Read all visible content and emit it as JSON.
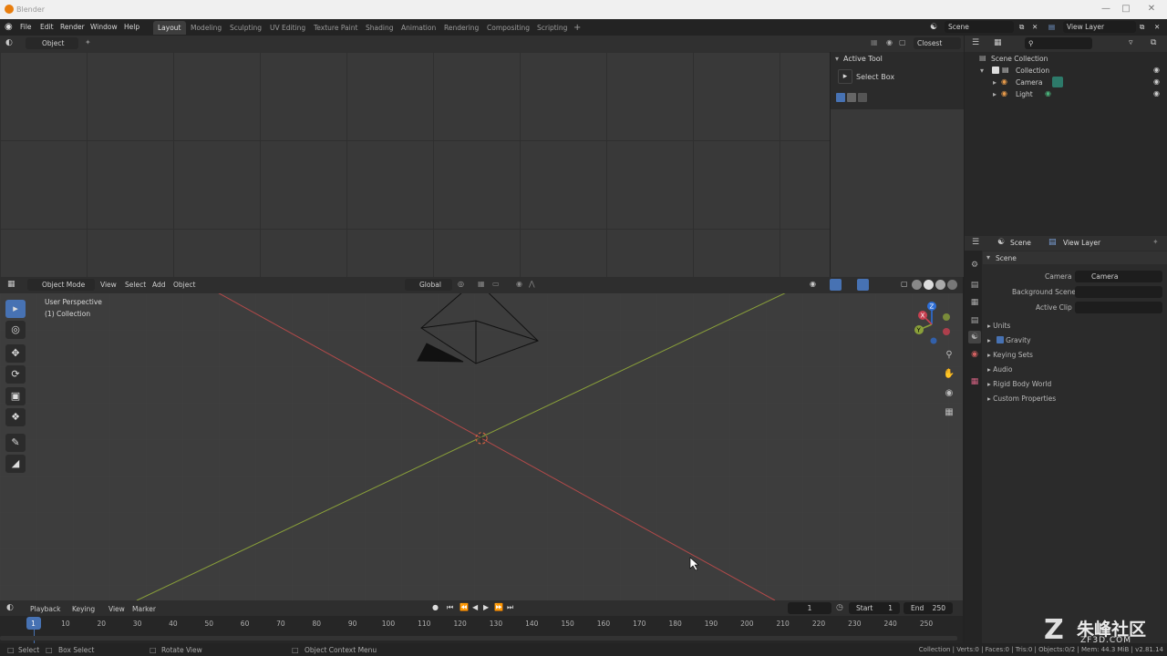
{
  "window": {
    "title": "Blender"
  },
  "menu": [
    "File",
    "Edit",
    "Render",
    "Window",
    "Help"
  ],
  "workspaces": [
    "Layout",
    "Modeling",
    "Sculpting",
    "UV Editing",
    "Texture Paint",
    "Shading",
    "Animation",
    "Rendering",
    "Compositing",
    "Scripting"
  ],
  "active_workspace": "Layout",
  "scene_selector": {
    "scene": "Scene",
    "view_layer": "View Layer"
  },
  "upper_editor": {
    "mode": "Object",
    "snap": "Closest"
  },
  "active_tool_panel": {
    "title": "Active Tool",
    "tool": "Select Box"
  },
  "viewport_header": {
    "mode": "Object Mode",
    "menus": [
      "View",
      "Select",
      "Add",
      "Object"
    ],
    "orientation": "Global"
  },
  "viewport_overlay": {
    "perspective": "User Perspective",
    "collection": "(1) Collection"
  },
  "outliner": {
    "root": "Scene Collection",
    "collection": "Collection",
    "items": [
      "Camera",
      "Light"
    ]
  },
  "properties": {
    "tabs": {
      "scene": "Scene",
      "view_layer": "View Layer"
    },
    "panel_title": "Scene",
    "camera_label": "Camera",
    "camera_value": "Camera",
    "background_scene_label": "Background Scene",
    "active_clip_label": "Active Clip",
    "sections": [
      "Units",
      "Gravity",
      "Keying Sets",
      "Audio",
      "Rigid Body World",
      "Custom Properties"
    ]
  },
  "timeline": {
    "menus": [
      "Playback",
      "Keying",
      "View",
      "Marker"
    ],
    "current_frame": "1",
    "start_label": "Start",
    "start_value": "1",
    "end_label": "End",
    "end_value": "250",
    "ruler": [
      "1",
      "10",
      "20",
      "30",
      "40",
      "50",
      "60",
      "70",
      "80",
      "90",
      "100",
      "110",
      "120",
      "130",
      "140",
      "150",
      "160",
      "170",
      "180",
      "190",
      "200",
      "210",
      "220",
      "230",
      "240",
      "250"
    ]
  },
  "statusbar": {
    "left": [
      "Select",
      "Box Select",
      "Rotate View",
      "Object Context Menu"
    ],
    "right": "Collection | Verts:0 | Faces:0 | Tris:0 | Objects:0/2 | Mem: 44.3 MiB | v2.81.14"
  },
  "watermark": {
    "text": "朱峰社区",
    "sub": "ZF3D.COM"
  },
  "colors": {
    "accent": "#4772b3",
    "x_axis": "#b34a4a",
    "y_axis": "#8aa03a",
    "bg": "#3d3d3d"
  }
}
